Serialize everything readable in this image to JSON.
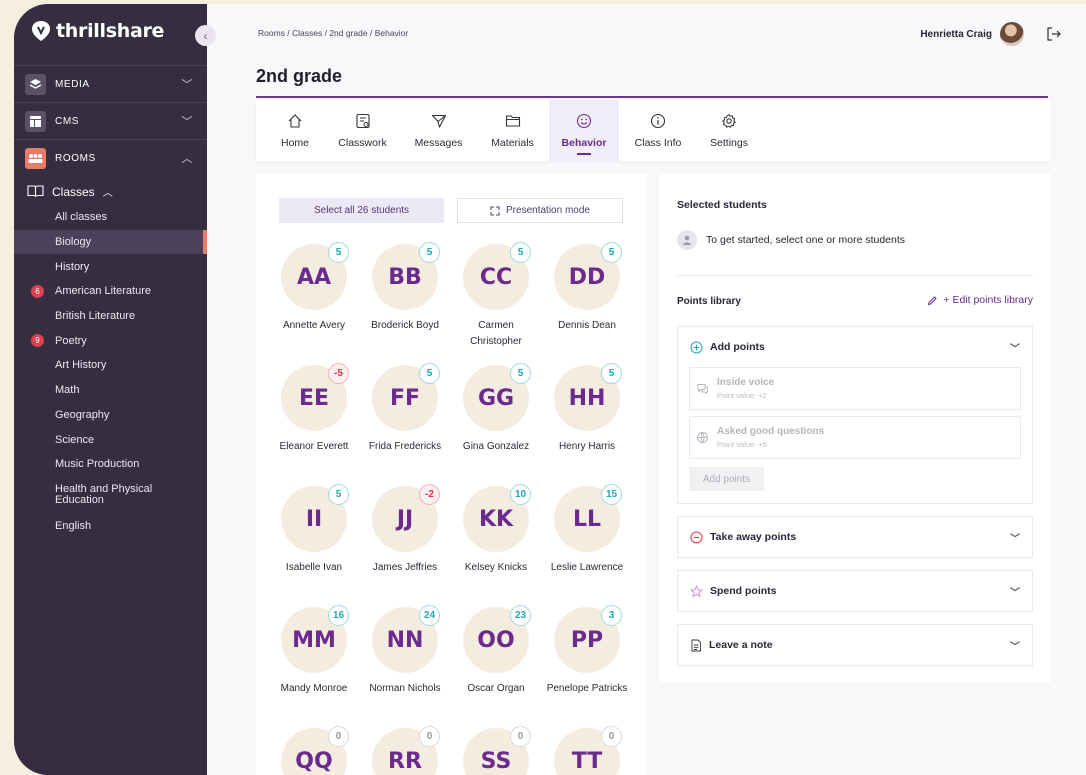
{
  "app": {
    "name": "thrillshare"
  },
  "sidebar": {
    "sections": [
      {
        "label": "MEDIA",
        "icon": "layers-icon",
        "chevron": "chevron-down-icon"
      },
      {
        "label": "CMS",
        "icon": "layout-icon",
        "chevron": "chevron-down-icon"
      },
      {
        "label": "ROOMS",
        "icon": "people-icon",
        "chevron": "chevron-up-icon"
      }
    ],
    "classes_label": "Classes",
    "items": [
      {
        "label": "All classes"
      },
      {
        "label": "Biology",
        "active": true
      },
      {
        "label": "History"
      },
      {
        "label": "American Literature",
        "badge": "6"
      },
      {
        "label": "British Literature"
      },
      {
        "label": "Poetry",
        "badge": "9"
      },
      {
        "label": "Art History"
      },
      {
        "label": "Math"
      },
      {
        "label": "Geography"
      },
      {
        "label": "Science"
      },
      {
        "label": "Music Production"
      },
      {
        "label": "Health and Physical Education"
      },
      {
        "label": "English"
      }
    ]
  },
  "header": {
    "breadcrumb": "Rooms  /  Classes  /  2nd grade  /  Behavior",
    "user_name": "Henrietta Craig",
    "page_title": "2nd grade"
  },
  "tabs": [
    {
      "label": "Home",
      "icon": "home-icon"
    },
    {
      "label": "Classwork",
      "icon": "classwork-icon"
    },
    {
      "label": "Messages",
      "icon": "send-icon"
    },
    {
      "label": "Materials",
      "icon": "folder-icon"
    },
    {
      "label": "Behavior",
      "icon": "smile-icon",
      "active": true
    },
    {
      "label": "Class Info",
      "icon": "info-icon"
    },
    {
      "label": "Settings",
      "icon": "gear-icon"
    }
  ],
  "students_panel": {
    "select_all": "Select all 26 students",
    "presentation": "Presentation mode",
    "students": [
      {
        "initials": "AA",
        "points": "5",
        "name": "Annette Avery"
      },
      {
        "initials": "BB",
        "points": "5",
        "name": "Broderick Boyd"
      },
      {
        "initials": "CC",
        "points": "5",
        "name": "Carmen Christopher"
      },
      {
        "initials": "DD",
        "points": "5",
        "name": "Dennis Dean"
      },
      {
        "initials": "EE",
        "points": "-5",
        "name": "Eleanor Everett"
      },
      {
        "initials": "FF",
        "points": "5",
        "name": "Frida Fredericks"
      },
      {
        "initials": "GG",
        "points": "5",
        "name": "Gina Gonzalez"
      },
      {
        "initials": "HH",
        "points": "5",
        "name": "Henry Harris"
      },
      {
        "initials": "II",
        "points": "5",
        "name": "Isabelle Ivan"
      },
      {
        "initials": "JJ",
        "points": "-2",
        "name": "James Jeffries"
      },
      {
        "initials": "KK",
        "points": "10",
        "name": "Kelsey Knicks"
      },
      {
        "initials": "LL",
        "points": "15",
        "name": "Leslie Lawrence"
      },
      {
        "initials": "MM",
        "points": "16",
        "name": "Mandy Monroe"
      },
      {
        "initials": "NN",
        "points": "24",
        "name": "Norman Nichols"
      },
      {
        "initials": "OO",
        "points": "23",
        "name": "Oscar Organ"
      },
      {
        "initials": "PP",
        "points": "3",
        "name": "Penelope Patricks"
      },
      {
        "initials": "QQ",
        "points": "0",
        "name": ""
      },
      {
        "initials": "RR",
        "points": "0",
        "name": ""
      },
      {
        "initials": "SS",
        "points": "0",
        "name": ""
      },
      {
        "initials": "TT",
        "points": "0",
        "name": ""
      }
    ]
  },
  "right_panel": {
    "selected_title": "Selected students",
    "hint": "To get started, select one or more students",
    "library_title": "Points library",
    "edit_library": "+ Edit points library",
    "add_points": {
      "title": "Add points",
      "items": [
        {
          "name": "Inside voice",
          "value": "Point value: +2",
          "icon": "chat-icon"
        },
        {
          "name": "Asked good questions",
          "value": "Point value: +5",
          "icon": "globe-icon"
        }
      ],
      "button": "Add points"
    },
    "take_away": "Take away points",
    "spend": "Spend points",
    "note": "Leave a note"
  },
  "colors": {
    "sidebar": "#352e40",
    "accent": "#6a2a8e",
    "teal": "#1fa7b4",
    "negative": "#d63646",
    "rooms": "#e87a6a"
  }
}
